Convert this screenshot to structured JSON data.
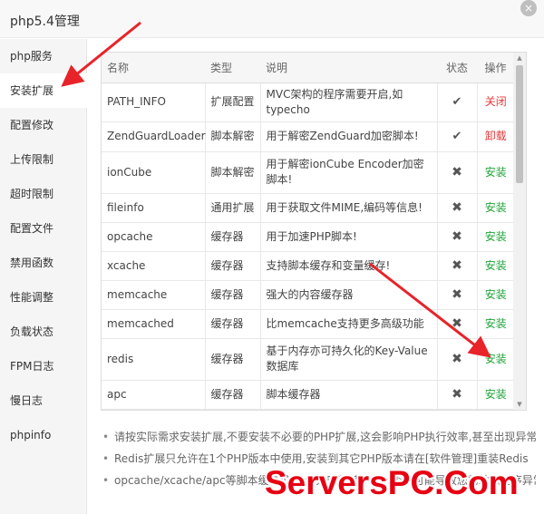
{
  "window": {
    "title": "php5.4管理",
    "close_icon": "×"
  },
  "sidebar": {
    "items": [
      {
        "label": "php服务"
      },
      {
        "label": "安装扩展",
        "active": true
      },
      {
        "label": "配置修改"
      },
      {
        "label": "上传限制"
      },
      {
        "label": "超时限制"
      },
      {
        "label": "配置文件"
      },
      {
        "label": "禁用函数"
      },
      {
        "label": "性能调整"
      },
      {
        "label": "负载状态"
      },
      {
        "label": "FPM日志"
      },
      {
        "label": "慢日志"
      },
      {
        "label": "phpinfo"
      }
    ]
  },
  "table": {
    "headers": {
      "name": "名称",
      "type": "类型",
      "desc": "说明",
      "status": "状态",
      "op": "操作"
    },
    "rows": [
      {
        "name": "PATH_INFO",
        "type": "扩展配置",
        "desc": "MVC架构的程序需要开启,如typecho",
        "status": "✔",
        "op": "关闭",
        "op_kind": "off"
      },
      {
        "name": "ZendGuardLoader",
        "type": "脚本解密",
        "desc": "用于解密ZendGuard加密脚本!",
        "status": "✔",
        "op": "卸载",
        "op_kind": "uninstall"
      },
      {
        "name": "ionCube",
        "type": "脚本解密",
        "desc": "用于解密ionCube Encoder加密脚本!",
        "status": "✖",
        "op": "安装",
        "op_kind": "install"
      },
      {
        "name": "fileinfo",
        "type": "通用扩展",
        "desc": "用于获取文件MIME,编码等信息!",
        "status": "✖",
        "op": "安装",
        "op_kind": "install"
      },
      {
        "name": "opcache",
        "type": "缓存器",
        "desc": "用于加速PHP脚本!",
        "status": "✖",
        "op": "安装",
        "op_kind": "install"
      },
      {
        "name": "xcache",
        "type": "缓存器",
        "desc": "支持脚本缓存和变量缓存!",
        "status": "✖",
        "op": "安装",
        "op_kind": "install"
      },
      {
        "name": "memcache",
        "type": "缓存器",
        "desc": "强大的内容缓存器",
        "status": "✖",
        "op": "安装",
        "op_kind": "install"
      },
      {
        "name": "memcached",
        "type": "缓存器",
        "desc": "比memcache支持更多高级功能",
        "status": "✖",
        "op": "安装",
        "op_kind": "install"
      },
      {
        "name": "redis",
        "type": "缓存器",
        "desc": "基于内存亦可持久化的Key-Value数据库",
        "status": "✖",
        "op": "安装",
        "op_kind": "install"
      },
      {
        "name": "apc",
        "type": "缓存器",
        "desc": "脚本缓存器",
        "status": "✖",
        "op": "安装",
        "op_kind": "install"
      }
    ]
  },
  "tips": [
    "请按实际需求安装扩展,不要安装不必要的PHP扩展,这会影响PHP执行效率,甚至出现异常",
    "Redis扩展只允许在1个PHP版本中使用,安装到其它PHP版本请在[软件管理]重装Redis",
    "opcache/xcache/apc等脚本缓存扩展,请只安装其中1个,否则可能导致您的站点程序异常"
  ],
  "watermark": "ServersPC.Com",
  "colors": {
    "install": "#20a53a",
    "danger": "#e4393c",
    "arrow": "#e8232a"
  },
  "icons": {
    "installed": "check-icon",
    "not_installed": "cross-icon"
  }
}
